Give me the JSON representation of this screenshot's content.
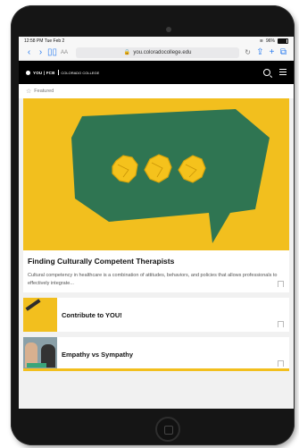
{
  "status": {
    "time_date": "12:58 PM  Tue Feb 2",
    "battery": "96%"
  },
  "browser": {
    "text_size_label": "AA",
    "url": "you.coloradocollege.edu",
    "icons": [
      "back-icon",
      "forward-icon",
      "book-icon",
      "lock-icon",
      "reload-icon",
      "share-icon",
      "add-icon",
      "tabs-icon"
    ]
  },
  "site": {
    "logo_text": "YOU | FCB",
    "logo_subtext": "COLORADO COLLEGE"
  },
  "featured": {
    "label": "Featured"
  },
  "main_card": {
    "title": "Finding Culturally Competent Therapists",
    "excerpt": "Cultural competency in healthcare is a combination of attitudes, behaviors, and policies that allows professionals to effectively integrate..."
  },
  "list": [
    {
      "title": "Contribute to YOU!"
    },
    {
      "title": "Empathy vs Sympathy"
    }
  ],
  "colors": {
    "brand_yellow": "#f2bf1e",
    "green": "#2f7552",
    "link_blue": "#2a7cf0"
  }
}
